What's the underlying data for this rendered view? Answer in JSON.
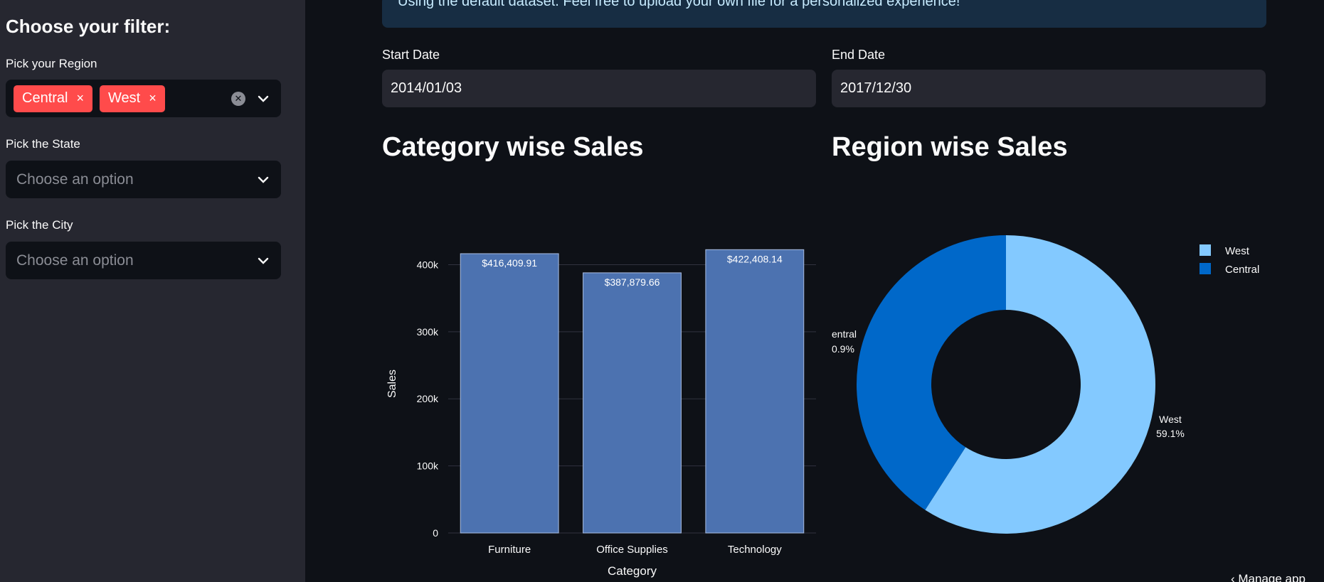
{
  "sidebar": {
    "heading": "Choose your filter:",
    "region": {
      "label": "Pick your Region",
      "tags": [
        "Central",
        "West"
      ],
      "tag_remove_glyph": "×"
    },
    "state": {
      "label": "Pick the State",
      "placeholder": "Choose an option"
    },
    "city": {
      "label": "Pick the City",
      "placeholder": "Choose an option"
    }
  },
  "main": {
    "banner_text": "Using the default dataset. Feel free to upload your own file for a personalized experience!",
    "start_date": {
      "label": "Start Date",
      "value": "2014/01/03"
    },
    "end_date": {
      "label": "End Date",
      "value": "2017/12/30"
    },
    "category_title": "Category wise Sales",
    "region_title": "Region wise Sales",
    "manage_app": "Manage app"
  },
  "colors": {
    "accent": "#ff4b4b",
    "bar": "#4c72b0",
    "west": "#83c9ff",
    "central": "#0068c9"
  },
  "chart_data": [
    {
      "type": "bar",
      "title": "Category wise Sales",
      "categories": [
        "Furniture",
        "Office Supplies",
        "Technology"
      ],
      "values": [
        416409.91,
        387879.66,
        422408.14
      ],
      "data_labels": [
        "$416,409.91",
        "$387,879.66",
        "$422,408.14"
      ],
      "xlabel": "Category",
      "ylabel": "Sales",
      "yticks": [
        "0",
        "100k",
        "200k",
        "300k",
        "400k"
      ],
      "ytick_values": [
        0,
        100000,
        200000,
        300000,
        400000
      ],
      "ylim": [
        0,
        445000
      ],
      "grid": true
    },
    {
      "type": "pie",
      "title": "Region wise Sales",
      "donut": true,
      "labels": [
        "West",
        "Central"
      ],
      "values": [
        59.1,
        40.9
      ],
      "slice_labels": [
        {
          "name": "West",
          "pct": "59.1%"
        },
        {
          "name": "entral",
          "pct": "0.9%"
        }
      ],
      "legend": [
        "West",
        "Central"
      ],
      "legend_position": "top-right"
    }
  ]
}
